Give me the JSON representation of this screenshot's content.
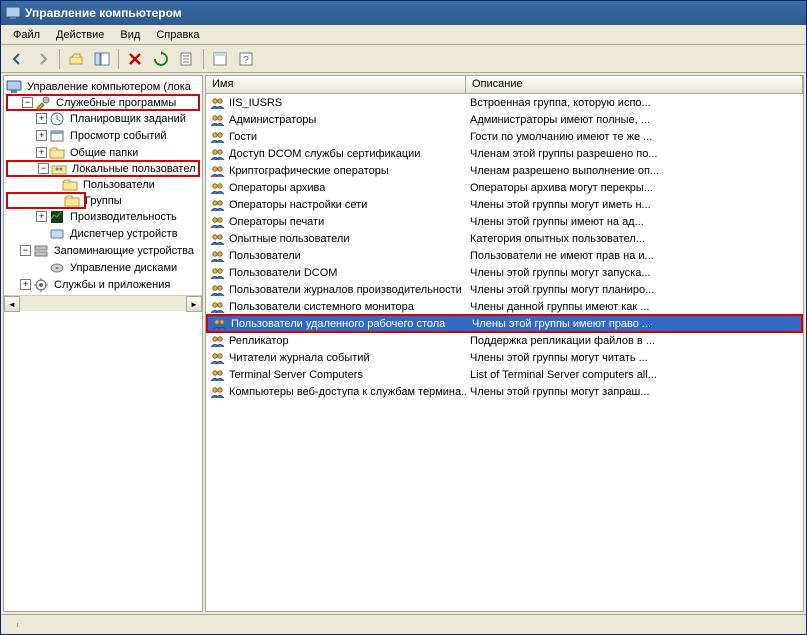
{
  "window": {
    "title": "Управление компьютером"
  },
  "menu": {
    "file": "Файл",
    "action": "Действие",
    "view": "Вид",
    "help": "Справка"
  },
  "tree": {
    "root": "Управление компьютером (лока",
    "utilities": "Служебные программы",
    "scheduler": "Планировщик заданий",
    "eventviewer": "Просмотр событий",
    "sharedfolders": "Общие папки",
    "localusers": "Локальные пользовател",
    "users": "Пользователи",
    "groups": "Группы",
    "perf": "Производительность",
    "devmgr": "Диспетчер устройств",
    "storage": "Запоминающие устройства",
    "diskmgmt": "Управление дисками",
    "services": "Службы и приложения"
  },
  "list": {
    "columns": {
      "name": "Имя",
      "description": "Описание"
    },
    "rows": [
      {
        "name": "IIS_IUSRS",
        "desc": "Встроенная группа, которую испо..."
      },
      {
        "name": "Администраторы",
        "desc": "Администраторы имеют полные, ..."
      },
      {
        "name": "Гости",
        "desc": "Гости по умолчанию имеют те же ..."
      },
      {
        "name": "Доступ DCOM службы сертификации",
        "desc": "Членам этой группы разрешено по..."
      },
      {
        "name": "Криптографические операторы",
        "desc": "Членам разрешено выполнение оп..."
      },
      {
        "name": "Операторы архива",
        "desc": "Операторы архива могут перекры..."
      },
      {
        "name": "Операторы настройки сети",
        "desc": "Члены этой группы могут иметь н..."
      },
      {
        "name": "Операторы печати",
        "desc": "Члены этой группы имеют на ад..."
      },
      {
        "name": "Опытные пользователи",
        "desc": "Категория опытных пользовател..."
      },
      {
        "name": "Пользователи",
        "desc": "Пользователи не имеют прав на и..."
      },
      {
        "name": "Пользователи DCOM",
        "desc": "Члены этой группы могут запуска..."
      },
      {
        "name": "Пользователи журналов производительности",
        "desc": "Члены этой группы могут планиро..."
      },
      {
        "name": "Пользователи системного монитора",
        "desc": "Члены данной группы имеют как ..."
      },
      {
        "name": "Пользователи удаленного рабочего стола",
        "desc": "Члены этой группы имеют право ...",
        "selected": true
      },
      {
        "name": "Репликатор",
        "desc": "Поддержка репликации файлов в ..."
      },
      {
        "name": "Читатели журнала событий",
        "desc": "Члены этой группы могут читать ..."
      },
      {
        "name": "Terminal Server Computers",
        "desc": "List of Terminal Server computers all..."
      },
      {
        "name": "Компьютеры веб-доступа к службам термина...",
        "desc": "Члены этой группы могут запраш..."
      }
    ]
  },
  "statusbar": {
    "text": ""
  }
}
